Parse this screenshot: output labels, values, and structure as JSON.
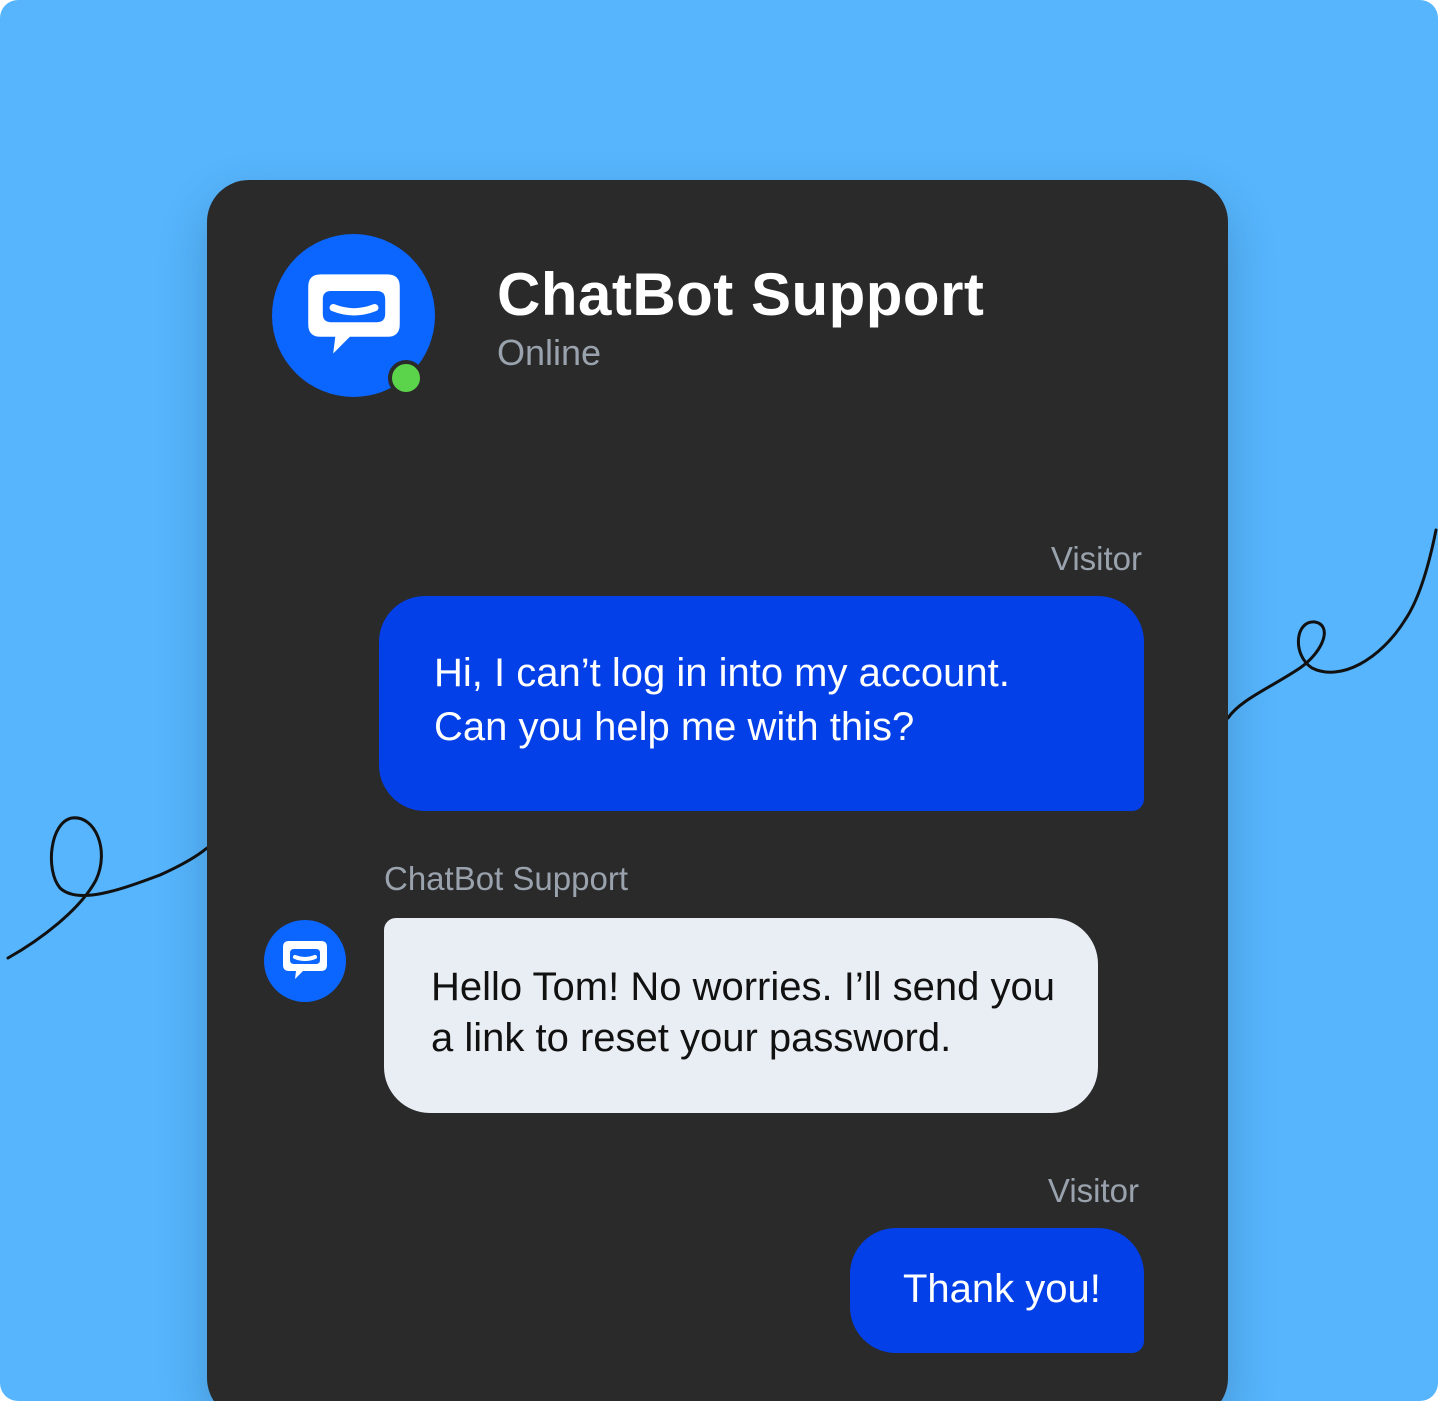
{
  "header": {
    "title": "ChatBot Support",
    "status": "Online",
    "avatar_icon": "chatbot-logo-icon",
    "status_color": "#5bd34a"
  },
  "messages": [
    {
      "sender": "Visitor",
      "lines": [
        "Hi, I can’t log in into my account.",
        "Can you help me with this?"
      ]
    },
    {
      "sender": "ChatBot Support",
      "avatar_icon": "chatbot-logo-icon",
      "lines": [
        "Hello Tom! No worries. I’ll send you",
        "a link to reset your password."
      ]
    },
    {
      "sender": "Visitor",
      "lines": [
        "Thank you!"
      ]
    }
  ],
  "colors": {
    "background": "#56b5fd",
    "panel": "#2a2a2b",
    "visitor_bubble": "#0340e8",
    "bot_bubble": "#e9eef4",
    "brand_blue": "#0a66ff"
  }
}
